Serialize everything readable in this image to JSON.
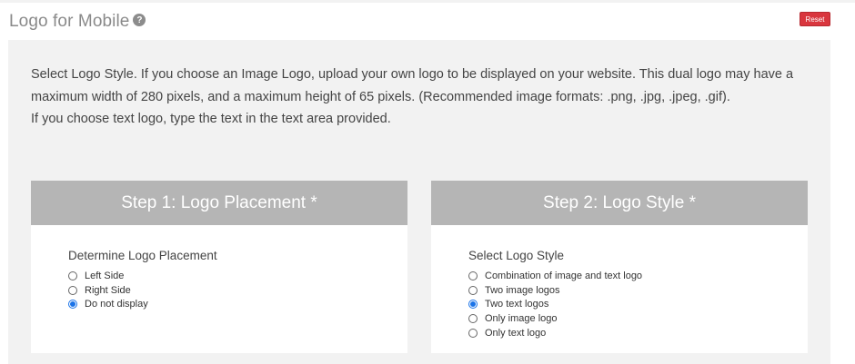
{
  "header": {
    "title": "Logo for Mobile",
    "help_icon": "?",
    "reset_label": "Reset"
  },
  "description": {
    "line1": "Select Logo Style. If you choose an Image Logo, upload your own logo to be displayed on your website. This dual logo may have a maximum width of 280 pixels, and a maximum height of 65 pixels. (Recommended image formats: .png, .jpg, .jpeg, .gif).",
    "line2": "If you choose text logo, type the text in the text area provided."
  },
  "step1": {
    "title": "Step 1: Logo Placement *",
    "label": "Determine Logo Placement",
    "options": [
      "Left Side",
      "Right Side",
      "Do not display"
    ],
    "selected": "Do not display"
  },
  "step2": {
    "title": "Step 2: Logo Style *",
    "label": "Select Logo Style",
    "options": [
      "Combination of image and text logo",
      "Two image logos",
      "Two text logos",
      "Only image logo",
      "Only text logo"
    ],
    "selected": "Two text logos"
  },
  "colors": {
    "reset_button": "#d9363e",
    "step_header": "#b5b5b5",
    "panel_background": "#f2f2f2",
    "radio_selected": "#1a73e8"
  }
}
